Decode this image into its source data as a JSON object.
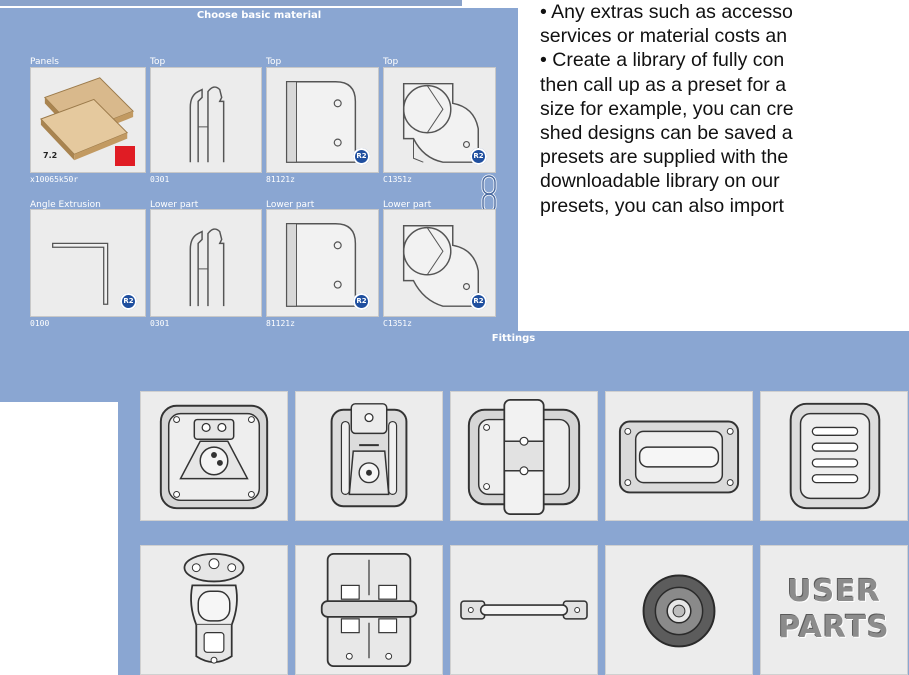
{
  "material_panel": {
    "title": "Choose basic material",
    "rows": [
      [
        {
          "label": "Panels",
          "code": "x10065k50r",
          "thickness": "7.2"
        },
        {
          "label": "Top",
          "code": "0301"
        },
        {
          "label": "Top",
          "code": "81121z"
        },
        {
          "label": "Top",
          "code": "C1351z"
        }
      ],
      [
        {
          "label": "Angle Extrusion",
          "code": "0100"
        },
        {
          "label": "Lower part",
          "code": "0301"
        },
        {
          "label": "Lower part",
          "code": "81121z"
        },
        {
          "label": "Lower part",
          "code": "C1351z"
        }
      ]
    ],
    "badge": "R2"
  },
  "overlay_text": [
    "• Any extras such as accesso",
    "services or material costs an",
    "• Create a library of fully con",
    "then call up as a preset for a",
    "size for example, you can cre",
    "shed designs can be saved a",
    "presets are supplied with the",
    "downloadable library on our",
    "presets, you can also import"
  ],
  "fittings_panel": {
    "title": "Fittings",
    "user_parts_line1": "USER",
    "user_parts_line2": "PARTS"
  },
  "colors": {
    "panel_bg": "#8aa6d2",
    "tile_bg": "#ececec",
    "badge": "#1f4f9f",
    "swatch": "#e01c24"
  }
}
